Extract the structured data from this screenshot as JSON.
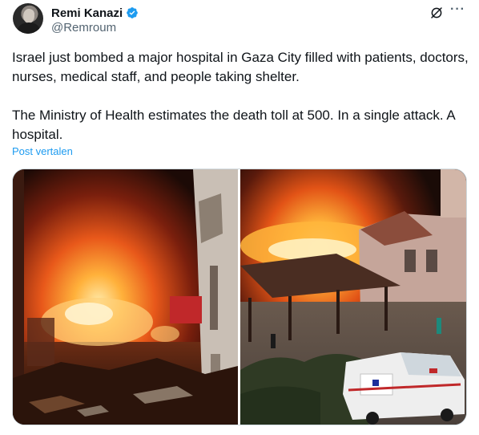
{
  "author": {
    "display_name": "Remi Kanazi",
    "handle": "@Remroum",
    "verified": true,
    "avatar_icon": "avatar-photo"
  },
  "actions": {
    "grok_icon": "grok-icon",
    "more_icon": "more-icon",
    "more_glyph": "···"
  },
  "tweet": {
    "paragraph_1": "Israel just bombed a major hospital in Gaza City filled with patients, doctors, nurses, medical staff, and people taking shelter.",
    "paragraph_2": "The Ministry of Health estimates the death toll at 500. In a single attack. A hospital.",
    "translate_label": "Post vertalen"
  },
  "media": {
    "count": 2,
    "photos": [
      {
        "name": "photo-fire-street"
      },
      {
        "name": "photo-fire-hospital-ambulance"
      }
    ]
  },
  "colors": {
    "accent": "#1d9bf0",
    "text_primary": "#0f1419",
    "text_secondary": "#536471",
    "border": "#cfd9de"
  }
}
